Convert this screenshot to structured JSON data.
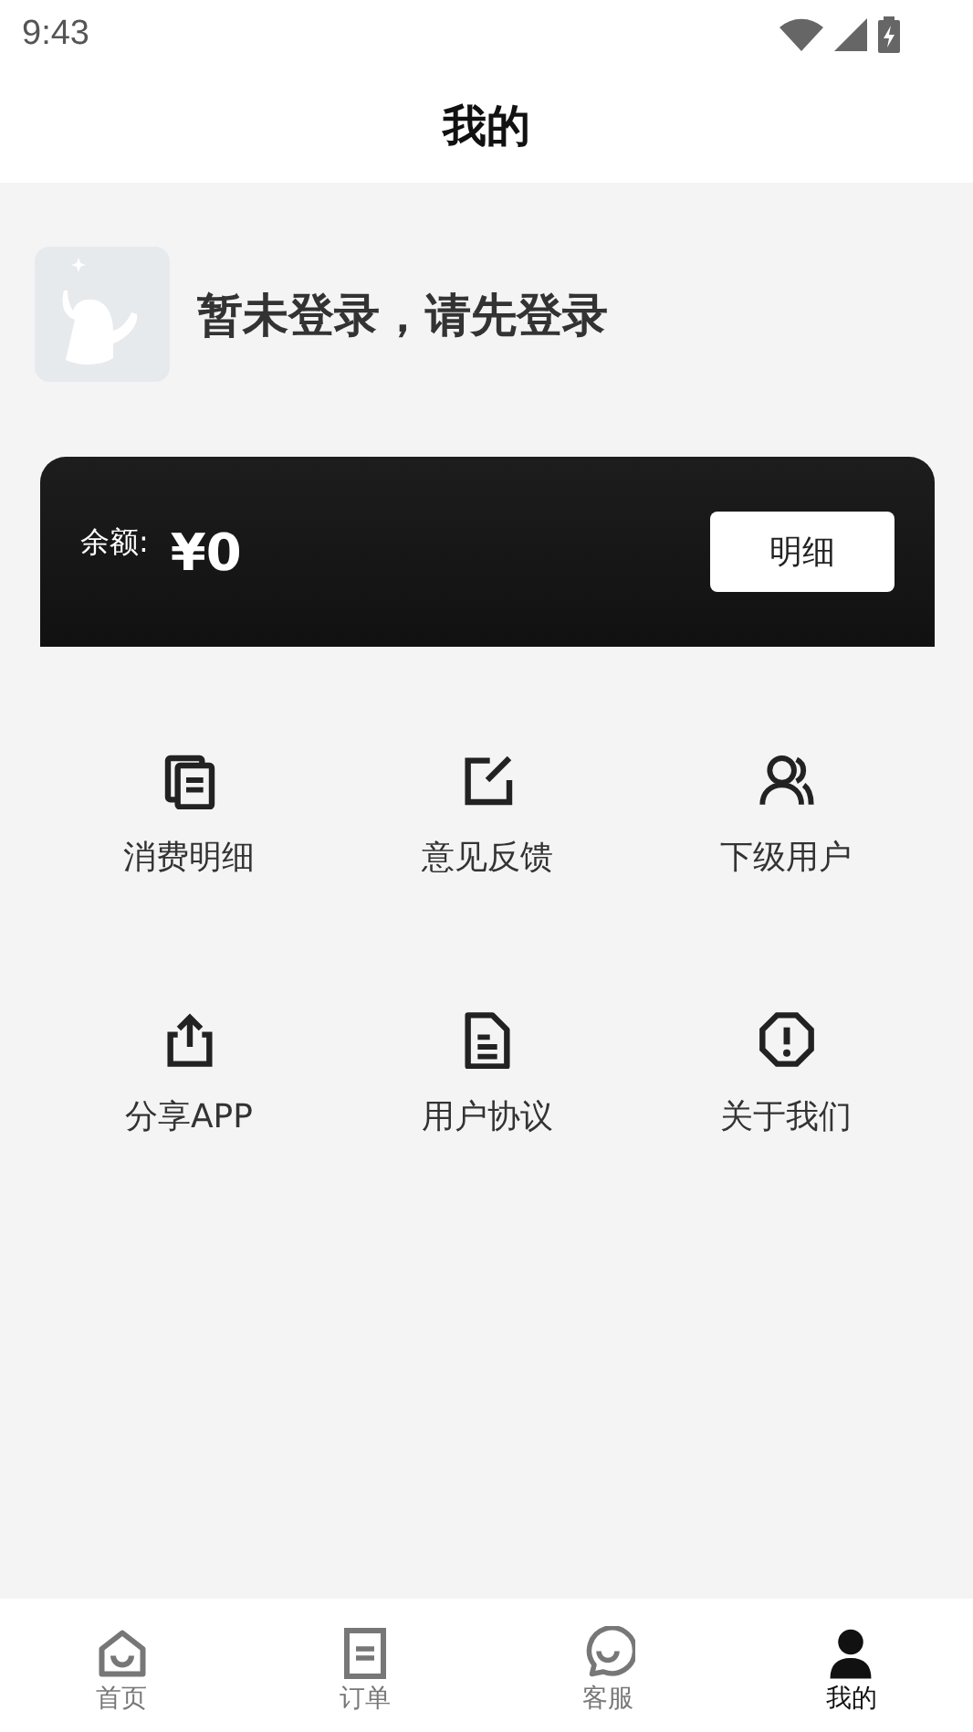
{
  "status_bar": {
    "time": "9:43"
  },
  "header": {
    "title": "我的"
  },
  "profile": {
    "message": "暂未登录，请先登录"
  },
  "balance": {
    "label": "余额:",
    "amount": "¥0",
    "button": "明细"
  },
  "menu": [
    {
      "kind": "copies",
      "label": "消费明细"
    },
    {
      "kind": "edit",
      "label": "意见反馈"
    },
    {
      "kind": "users",
      "label": "下级用户"
    },
    {
      "kind": "share",
      "label": "分享APP"
    },
    {
      "kind": "document",
      "label": "用户协议"
    },
    {
      "kind": "alert",
      "label": "关于我们"
    }
  ],
  "tabs": [
    {
      "kind": "home",
      "label": "首页",
      "selected": false
    },
    {
      "kind": "orders",
      "label": "订单",
      "selected": false
    },
    {
      "kind": "chat",
      "label": "客服",
      "selected": false
    },
    {
      "kind": "person",
      "label": "我的",
      "selected": true
    }
  ]
}
